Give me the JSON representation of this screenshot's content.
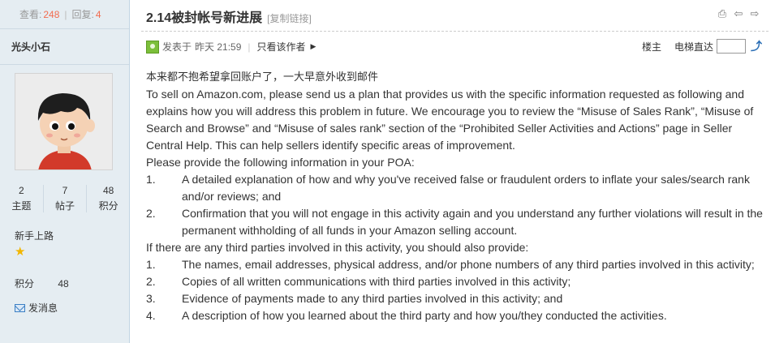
{
  "sidebar": {
    "views_label": "查看:",
    "views_count": "248",
    "replies_label": "回复:",
    "replies_count": "4",
    "username": "光头小石",
    "counts": [
      {
        "value": "2",
        "label": "主题"
      },
      {
        "value": "7",
        "label": "帖子"
      },
      {
        "value": "48",
        "label": "积分"
      }
    ],
    "rank_title": "新手上路",
    "points_label": "积分",
    "points_value": "48",
    "send_message": "发消息"
  },
  "post": {
    "title": "2.14被封帐号新进展",
    "copy_link": "[复制链接]",
    "posted_label": "发表于",
    "posted_time": "昨天 21:59",
    "author_only": "只看该作者",
    "floor_label": "楼主",
    "elevator_label": "电梯直达",
    "paragraphs": [
      "本来都不抱希望拿回账户了，一大早意外收到邮件",
      "To sell on Amazon.com, please send us a plan that provides us with the specific information requested as following and explains how you will address this problem in future. We encourage you to review the “Misuse of Sales Rank”, “Misuse of Search and Browse” and “Misuse of sales rank” section of the “Prohibited Seller Activities and Actions” page in Seller Central Help. This can help sellers identify specific areas of improvement.",
      "Please provide the following information in your POA:"
    ],
    "list1": [
      {
        "n": "1.",
        "t": "A detailed explanation of how and why you've received false or fraudulent orders to inflate your sales/search rank and/or reviews; and"
      },
      {
        "n": "2.",
        "t": "Confirmation that you will not engage in this activity again and you understand any further violations will result in the permanent withholding of all funds in your Amazon selling account."
      }
    ],
    "third_party_intro": "If there are any third parties involved in this activity, you should also provide:",
    "list2": [
      {
        "n": "1.",
        "t": "The names, email addresses, physical address, and/or phone numbers of any third parties involved in this activity;"
      },
      {
        "n": "2.",
        "t": "Copies of all written communications with third parties involved in this activity;"
      },
      {
        "n": "3.",
        "t": "Evidence of payments made to any third parties involved in this activity; and"
      },
      {
        "n": "4.",
        "t": "A description of how you learned about the third party and how you/they conducted the activities."
      }
    ]
  },
  "icons": {
    "print": "print-icon",
    "prev": "prev-thread-icon",
    "next": "next-thread-icon",
    "go": "go-icon",
    "star": "star-icon",
    "message": "envelope-icon"
  }
}
